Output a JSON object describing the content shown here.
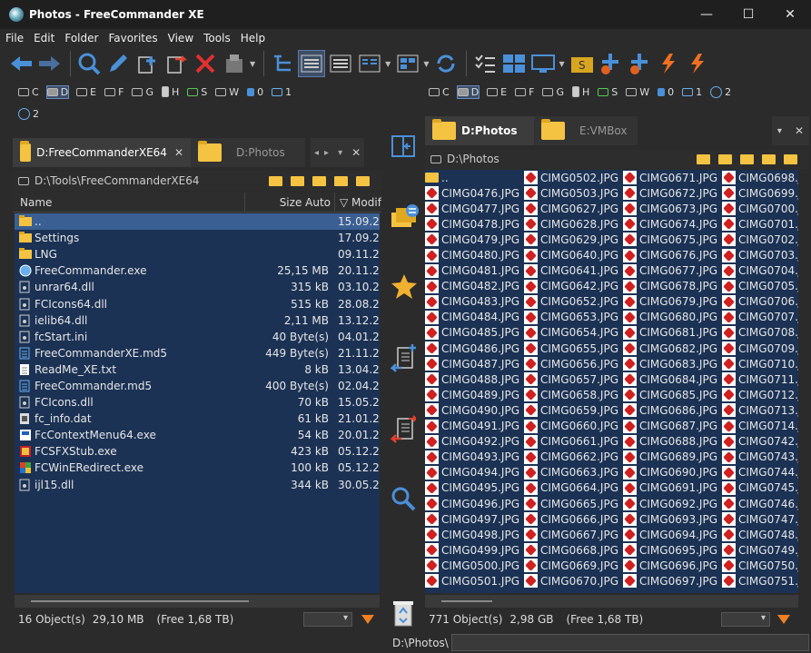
{
  "window": {
    "title": "Photos - FreeCommander XE"
  },
  "menu": [
    "File",
    "Edit",
    "Folder",
    "Favorites",
    "View",
    "Tools",
    "Help"
  ],
  "drives": {
    "left_row1": [
      {
        "letter": "C"
      },
      {
        "letter": "D",
        "active": true
      },
      {
        "letter": "E"
      },
      {
        "letter": "F"
      },
      {
        "letter": "G"
      },
      {
        "letter": "H"
      },
      {
        "letter": "S"
      },
      {
        "letter": "W"
      },
      {
        "letter": "0"
      },
      {
        "letter": "1"
      }
    ],
    "left_row2": [
      {
        "letter": "2"
      }
    ],
    "right_row1": [
      {
        "letter": "C"
      },
      {
        "letter": "D",
        "active": true
      },
      {
        "letter": "E"
      },
      {
        "letter": "F"
      },
      {
        "letter": "G"
      },
      {
        "letter": "H"
      },
      {
        "letter": "S"
      },
      {
        "letter": "W"
      },
      {
        "letter": "0"
      },
      {
        "letter": "1"
      },
      {
        "letter": "2"
      }
    ]
  },
  "left": {
    "tabs": [
      {
        "label": "D:FreeCommanderXE64",
        "active": true
      },
      {
        "label": "D:Photos",
        "active": false
      }
    ],
    "path": "D:\\Tools\\FreeCommanderXE64",
    "columns": {
      "name": "Name",
      "size": "Size Auto",
      "date": "▽ Modif"
    },
    "files": [
      {
        "name": "..",
        "size": "",
        "date": "15.09.2",
        "type": "up"
      },
      {
        "name": "Settings",
        "size": "",
        "date": "17.09.2",
        "type": "folder"
      },
      {
        "name": "LNG",
        "size": "",
        "date": "09.11.2",
        "type": "folder"
      },
      {
        "name": "FreeCommander.exe",
        "size": "25,15 MB",
        "date": "20.11.2",
        "type": "app"
      },
      {
        "name": "unrar64.dll",
        "size": "315 kB",
        "date": "03.10.2",
        "type": "dll"
      },
      {
        "name": "FCIcons64.dll",
        "size": "515 kB",
        "date": "28.08.2",
        "type": "dll"
      },
      {
        "name": "ielib64.dll",
        "size": "2,11 MB",
        "date": "13.12.2",
        "type": "dll"
      },
      {
        "name": "fcStart.ini",
        "size": "40 Byte(s)",
        "date": "04.01.2",
        "type": "ini"
      },
      {
        "name": "FreeCommanderXE.md5",
        "size": "449 Byte(s)",
        "date": "21.11.2",
        "type": "md5"
      },
      {
        "name": "ReadMe_XE.txt",
        "size": "8 kB",
        "date": "13.04.2",
        "type": "txt"
      },
      {
        "name": "FreeCommander.md5",
        "size": "400 Byte(s)",
        "date": "02.04.2",
        "type": "md5"
      },
      {
        "name": "FCIcons.dll",
        "size": "70 kB",
        "date": "15.05.2",
        "type": "dll"
      },
      {
        "name": "fc_info.dat",
        "size": "61 kB",
        "date": "21.01.2",
        "type": "dat"
      },
      {
        "name": "FcContextMenu64.exe",
        "size": "54 kB",
        "date": "20.01.2",
        "type": "exe"
      },
      {
        "name": "FCSFXStub.exe",
        "size": "423 kB",
        "date": "05.12.2",
        "type": "exe2"
      },
      {
        "name": "FCWinERedirect.exe",
        "size": "100 kB",
        "date": "05.12.2",
        "type": "exe3"
      },
      {
        "name": "ijl15.dll",
        "size": "344 kB",
        "date": "30.05.2",
        "type": "dll"
      }
    ],
    "status": {
      "objects": "16 Object(s)",
      "size": "29,10 MB",
      "free": "(Free 1,68 TB)"
    }
  },
  "right": {
    "tabs": [
      {
        "label": "D:Photos",
        "active": true
      },
      {
        "label": "E:VMBox",
        "active": false
      }
    ],
    "path": "D:\\Photos",
    "columns": [
      [
        "..",
        "CIMG0476.JPG",
        "CIMG0477.JPG",
        "CIMG0478.JPG",
        "CIMG0479.JPG",
        "CIMG0480.JPG",
        "CIMG0481.JPG",
        "CIMG0482.JPG",
        "CIMG0483.JPG",
        "CIMG0484.JPG",
        "CIMG0485.JPG",
        "CIMG0486.JPG",
        "CIMG0487.JPG",
        "CIMG0488.JPG",
        "CIMG0489.JPG",
        "CIMG0490.JPG",
        "CIMG0491.JPG",
        "CIMG0492.JPG",
        "CIMG0493.JPG",
        "CIMG0494.JPG",
        "CIMG0495.JPG",
        "CIMG0496.JPG",
        "CIMG0497.JPG",
        "CIMG0498.JPG",
        "CIMG0499.JPG",
        "CIMG0500.JPG",
        "CIMG0501.JPG"
      ],
      [
        "CIMG0502.JPG",
        "CIMG0503.JPG",
        "CIMG0627.JPG",
        "CIMG0628.JPG",
        "CIMG0629.JPG",
        "CIMG0640.JPG",
        "CIMG0641.JPG",
        "CIMG0642.JPG",
        "CIMG0652.JPG",
        "CIMG0653.JPG",
        "CIMG0654.JPG",
        "CIMG0655.JPG",
        "CIMG0656.JPG",
        "CIMG0657.JPG",
        "CIMG0658.JPG",
        "CIMG0659.JPG",
        "CIMG0660.JPG",
        "CIMG0661.JPG",
        "CIMG0662.JPG",
        "CIMG0663.JPG",
        "CIMG0664.JPG",
        "CIMG0665.JPG",
        "CIMG0666.JPG",
        "CIMG0667.JPG",
        "CIMG0668.JPG",
        "CIMG0669.JPG",
        "CIMG0670.JPG"
      ],
      [
        "CIMG0671.JPG",
        "CIMG0672.JPG",
        "CIMG0673.JPG",
        "CIMG0674.JPG",
        "CIMG0675.JPG",
        "CIMG0676.JPG",
        "CIMG0677.JPG",
        "CIMG0678.JPG",
        "CIMG0679.JPG",
        "CIMG0680.JPG",
        "CIMG0681.JPG",
        "CIMG0682.JPG",
        "CIMG0683.JPG",
        "CIMG0684.JPG",
        "CIMG0685.JPG",
        "CIMG0686.JPG",
        "CIMG0687.JPG",
        "CIMG0688.JPG",
        "CIMG0689.JPG",
        "CIMG0690.JPG",
        "CIMG0691.JPG",
        "CIMG0692.JPG",
        "CIMG0693.JPG",
        "CIMG0694.JPG",
        "CIMG0695.JPG",
        "CIMG0696.JPG",
        "CIMG0697.JPG"
      ],
      [
        "CIMG0698.J",
        "CIMG0699.J",
        "CIMG0700.J",
        "CIMG0701.J",
        "CIMG0702.J",
        "CIMG0703.J",
        "CIMG0704.J",
        "CIMG0705.J",
        "CIMG0706.J",
        "CIMG0707.J",
        "CIMG0708.J",
        "CIMG0709.J",
        "CIMG0710.J",
        "CIMG0711.J",
        "CIMG0712.J",
        "CIMG0713.J",
        "CIMG0714.J",
        "CIMG0742.J",
        "CIMG0743.J",
        "CIMG0744.J",
        "CIMG0745.J",
        "CIMG0746.J",
        "CIMG0747.J",
        "CIMG0748.J",
        "CIMG0749.J",
        "CIMG0750.J",
        "CIMG0751.J"
      ]
    ],
    "status": {
      "objects": "771 Object(s)",
      "size": "2,98 GB",
      "free": "(Free 1,68 TB)"
    }
  },
  "bottom": {
    "path": "D:\\Photos\\"
  },
  "colors": {
    "list_bg": "#1b3254",
    "selected": "#3a5f93",
    "accent": "#4a90d9",
    "folder": "#f5c342"
  }
}
